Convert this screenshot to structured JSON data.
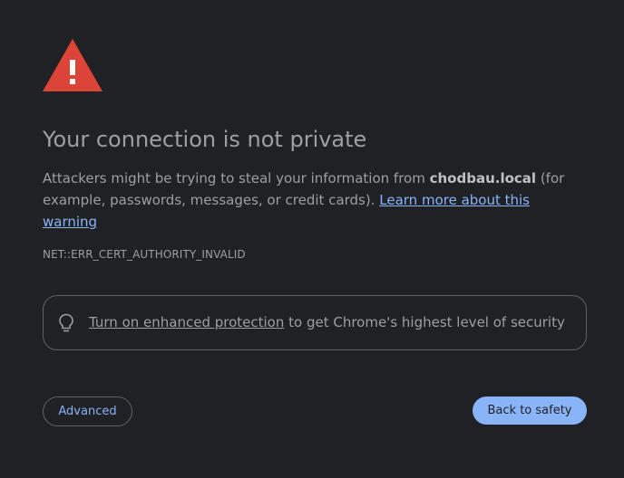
{
  "interstitial": {
    "icon": "warning-triangle-icon",
    "heading": "Your connection is not private",
    "explanation": {
      "prefix": "Attackers might be trying to steal your information from ",
      "hostname": "chodbau.local",
      "suffix": " (for example, passwords, messages, or credit cards). ",
      "learn_more_link": "Learn more about this warning"
    },
    "error_code": "NET::ERR_CERT_AUTHORITY_INVALID",
    "enhanced_protection": {
      "icon": "lightbulb-icon",
      "link_text": "Turn on enhanced protection",
      "rest_text": " to get Chrome's highest level of security"
    },
    "advanced_label": "Advanced",
    "back_label": "Back to safety"
  },
  "colors": {
    "background": "#202124",
    "text": "#9aa0a6",
    "link": "#8ab4f8",
    "warning": "#db4437",
    "border": "#5f6368",
    "primary_button": "#8ab4f8"
  }
}
